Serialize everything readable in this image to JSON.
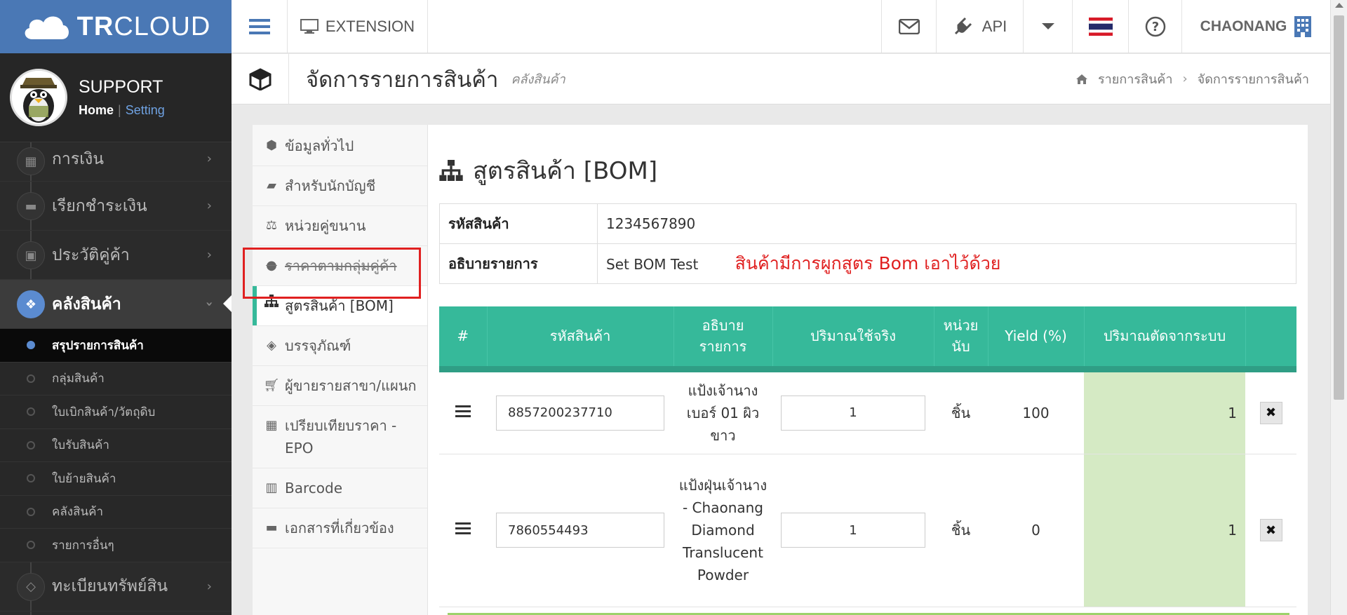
{
  "brand": {
    "logo_bold": "TR",
    "logo_light": "CLOUD"
  },
  "topbar": {
    "extension_label": "EXTENSION",
    "api_label": "API",
    "company_name": "CHAONANG"
  },
  "profile": {
    "name": "SUPPORT",
    "home_link": "Home",
    "separator": "|",
    "setting_link": "Setting"
  },
  "sidebar": {
    "items": [
      {
        "label": "การเงิน",
        "icon": "calendar-icon"
      },
      {
        "label": "เรียกชำระเงิน",
        "icon": "credit-card-icon"
      },
      {
        "label": "ประวัติคู่ค้า",
        "icon": "contact-icon"
      },
      {
        "label": "คลังสินค้า",
        "icon": "cubes-icon",
        "active": true
      }
    ],
    "sub_items": [
      {
        "label": "สรุปรายการสินค้า",
        "active": true
      },
      {
        "label": "กลุ่มสินค้า"
      },
      {
        "label": "ใบเบิกสินค้า/วัตถุดิบ"
      },
      {
        "label": "ใบรับสินค้า"
      },
      {
        "label": "ใบย้ายสินค้า"
      },
      {
        "label": "คลังสินค้า"
      },
      {
        "label": "รายการอื่นๆ"
      }
    ],
    "bottom_item": {
      "label": "ทะเบียนทรัพย์สิน",
      "icon": "diamond-icon"
    }
  },
  "page_header": {
    "title": "จัดการรายการสินค้า",
    "subtitle": "คลังสินค้า",
    "breadcrumb": [
      "รายการสินค้า",
      "จัดการรายการสินค้า"
    ]
  },
  "tabs": [
    {
      "label": "ข้อมูลทั่วไป",
      "icon": "cube-icon"
    },
    {
      "label": "สำหรับนักบัญชี",
      "icon": "book-icon"
    },
    {
      "label": "หน่วยคู่ขนาน",
      "icon": "scale-icon"
    },
    {
      "label": "ราคาตามกลุ่มคู่ค้า",
      "icon": "users-icon"
    },
    {
      "label": "สูตรสินค้า [BOM]",
      "icon": "sitemap-icon",
      "active": true
    },
    {
      "label": "บรรจุภัณฑ์",
      "icon": "dropbox-icon"
    },
    {
      "label": "ผู้ขายรายสาขา/แผนก",
      "icon": "cart-icon"
    },
    {
      "label": "เปรียบเทียบราคา - EPO",
      "icon": "table-icon"
    },
    {
      "label": "Barcode",
      "icon": "barcode-icon"
    },
    {
      "label": "เอกสารที่เกี่ยวข้อง",
      "icon": "folder-icon"
    }
  ],
  "bom": {
    "title": "สูตรสินค้า [BOM]",
    "product_code_label": "รหัสสินค้า",
    "product_code": "1234567890",
    "description_label": "อธิบายรายการ",
    "description": "Set BOM Test",
    "annotation": "สินค้ามีการผูกสูตร Bom เอาไว้ด้วย",
    "columns": {
      "index": "#",
      "code": "รหัสสินค้า",
      "desc_line1": "อธิบาย",
      "desc_line2": "รายการ",
      "actual_qty": "ปริมาณใช้จริง",
      "unit_line1": "หน่วย",
      "unit_line2": "นับ",
      "yield": "Yield (%)",
      "system_qty": "ปริมาณตัดจากระบบ"
    },
    "rows": [
      {
        "code": "8857200237710",
        "description": "แป้งเจ้านาง เบอร์ 01 ผิวขาว",
        "actual_qty": "1",
        "unit": "ชิ้น",
        "yield": "100",
        "system_qty": "1"
      },
      {
        "code": "7860554493",
        "description": "แป้งฝุ่นเจ้านาง - Chaonang Diamond Translucent Powder",
        "actual_qty": "1",
        "unit": "ชิ้น",
        "yield": "0",
        "system_qty": "1"
      }
    ],
    "delete_symbol": "✖"
  },
  "colors": {
    "brand_blue": "#4a78b5",
    "accent_green": "#36b99a",
    "system_qty_bg": "#d5eac4",
    "annotation_red": "#e02020",
    "sidebar_bg": "#2b2b2b"
  }
}
